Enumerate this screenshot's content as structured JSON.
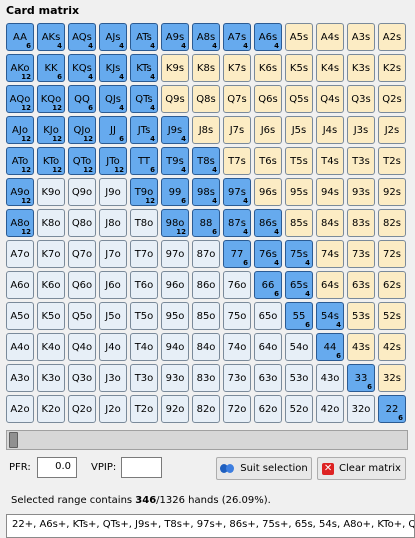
{
  "panel": {
    "title": "Card matrix"
  },
  "matrix": {
    "rows": [
      [
        [
          "AA",
          "6",
          true
        ],
        [
          "AKs",
          "4",
          true
        ],
        [
          "AQs",
          "4",
          true
        ],
        [
          "AJs",
          "4",
          true
        ],
        [
          "ATs",
          "4",
          true
        ],
        [
          "A9s",
          "4",
          true
        ],
        [
          "A8s",
          "4",
          true
        ],
        [
          "A7s",
          "4",
          true
        ],
        [
          "A6s",
          "4",
          true
        ],
        [
          "A5s",
          "",
          false
        ],
        [
          "A4s",
          "",
          false
        ],
        [
          "A3s",
          "",
          false
        ],
        [
          "A2s",
          "",
          false
        ]
      ],
      [
        [
          "AKo",
          "12",
          true
        ],
        [
          "KK",
          "6",
          true
        ],
        [
          "KQs",
          "4",
          true
        ],
        [
          "KJs",
          "4",
          true
        ],
        [
          "KTs",
          "4",
          true
        ],
        [
          "K9s",
          "",
          false
        ],
        [
          "K8s",
          "",
          false
        ],
        [
          "K7s",
          "",
          false
        ],
        [
          "K6s",
          "",
          false
        ],
        [
          "K5s",
          "",
          false
        ],
        [
          "K4s",
          "",
          false
        ],
        [
          "K3s",
          "",
          false
        ],
        [
          "K2s",
          "",
          false
        ]
      ],
      [
        [
          "AQo",
          "12",
          true
        ],
        [
          "KQo",
          "12",
          true
        ],
        [
          "QQ",
          "6",
          true
        ],
        [
          "QJs",
          "4",
          true
        ],
        [
          "QTs",
          "4",
          true
        ],
        [
          "Q9s",
          "",
          false
        ],
        [
          "Q8s",
          "",
          false
        ],
        [
          "Q7s",
          "",
          false
        ],
        [
          "Q6s",
          "",
          false
        ],
        [
          "Q5s",
          "",
          false
        ],
        [
          "Q4s",
          "",
          false
        ],
        [
          "Q3s",
          "",
          false
        ],
        [
          "Q2s",
          "",
          false
        ]
      ],
      [
        [
          "AJo",
          "12",
          true
        ],
        [
          "KJo",
          "12",
          true
        ],
        [
          "QJo",
          "12",
          true
        ],
        [
          "JJ",
          "6",
          true
        ],
        [
          "JTs",
          "4",
          true
        ],
        [
          "J9s",
          "4",
          true
        ],
        [
          "J8s",
          "",
          false
        ],
        [
          "J7s",
          "",
          false
        ],
        [
          "J6s",
          "",
          false
        ],
        [
          "J5s",
          "",
          false
        ],
        [
          "J4s",
          "",
          false
        ],
        [
          "J3s",
          "",
          false
        ],
        [
          "J2s",
          "",
          false
        ]
      ],
      [
        [
          "ATo",
          "12",
          true
        ],
        [
          "KTo",
          "12",
          true
        ],
        [
          "QTo",
          "12",
          true
        ],
        [
          "JTo",
          "12",
          true
        ],
        [
          "TT",
          "6",
          true
        ],
        [
          "T9s",
          "4",
          true
        ],
        [
          "T8s",
          "4",
          true
        ],
        [
          "T7s",
          "",
          false
        ],
        [
          "T6s",
          "",
          false
        ],
        [
          "T5s",
          "",
          false
        ],
        [
          "T4s",
          "",
          false
        ],
        [
          "T3s",
          "",
          false
        ],
        [
          "T2s",
          "",
          false
        ]
      ],
      [
        [
          "A9o",
          "12",
          true
        ],
        [
          "K9o",
          "",
          false
        ],
        [
          "Q9o",
          "",
          false
        ],
        [
          "J9o",
          "",
          false
        ],
        [
          "T9o",
          "12",
          true
        ],
        [
          "99",
          "6",
          true
        ],
        [
          "98s",
          "4",
          true
        ],
        [
          "97s",
          "4",
          true
        ],
        [
          "96s",
          "",
          false
        ],
        [
          "95s",
          "",
          false
        ],
        [
          "94s",
          "",
          false
        ],
        [
          "93s",
          "",
          false
        ],
        [
          "92s",
          "",
          false
        ]
      ],
      [
        [
          "A8o",
          "12",
          true
        ],
        [
          "K8o",
          "",
          false
        ],
        [
          "Q8o",
          "",
          false
        ],
        [
          "J8o",
          "",
          false
        ],
        [
          "T8o",
          "",
          false
        ],
        [
          "98o",
          "12",
          true
        ],
        [
          "88",
          "6",
          true
        ],
        [
          "87s",
          "4",
          true
        ],
        [
          "86s",
          "4",
          true
        ],
        [
          "85s",
          "",
          false
        ],
        [
          "84s",
          "",
          false
        ],
        [
          "83s",
          "",
          false
        ],
        [
          "82s",
          "",
          false
        ]
      ],
      [
        [
          "A7o",
          "",
          false
        ],
        [
          "K7o",
          "",
          false
        ],
        [
          "Q7o",
          "",
          false
        ],
        [
          "J7o",
          "",
          false
        ],
        [
          "T7o",
          "",
          false
        ],
        [
          "97o",
          "",
          false
        ],
        [
          "87o",
          "",
          false
        ],
        [
          "77",
          "6",
          true
        ],
        [
          "76s",
          "4",
          true
        ],
        [
          "75s",
          "4",
          true
        ],
        [
          "74s",
          "",
          false
        ],
        [
          "73s",
          "",
          false
        ],
        [
          "72s",
          "",
          false
        ]
      ],
      [
        [
          "A6o",
          "",
          false
        ],
        [
          "K6o",
          "",
          false
        ],
        [
          "Q6o",
          "",
          false
        ],
        [
          "J6o",
          "",
          false
        ],
        [
          "T6o",
          "",
          false
        ],
        [
          "96o",
          "",
          false
        ],
        [
          "86o",
          "",
          false
        ],
        [
          "76o",
          "",
          false
        ],
        [
          "66",
          "6",
          true
        ],
        [
          "65s",
          "4",
          true
        ],
        [
          "64s",
          "",
          false
        ],
        [
          "63s",
          "",
          false
        ],
        [
          "62s",
          "",
          false
        ]
      ],
      [
        [
          "A5o",
          "",
          false
        ],
        [
          "K5o",
          "",
          false
        ],
        [
          "Q5o",
          "",
          false
        ],
        [
          "J5o",
          "",
          false
        ],
        [
          "T5o",
          "",
          false
        ],
        [
          "95o",
          "",
          false
        ],
        [
          "85o",
          "",
          false
        ],
        [
          "75o",
          "",
          false
        ],
        [
          "65o",
          "",
          false
        ],
        [
          "55",
          "6",
          true
        ],
        [
          "54s",
          "4",
          true
        ],
        [
          "53s",
          "",
          false
        ],
        [
          "52s",
          "",
          false
        ]
      ],
      [
        [
          "A4o",
          "",
          false
        ],
        [
          "K4o",
          "",
          false
        ],
        [
          "Q4o",
          "",
          false
        ],
        [
          "J4o",
          "",
          false
        ],
        [
          "T4o",
          "",
          false
        ],
        [
          "94o",
          "",
          false
        ],
        [
          "84o",
          "",
          false
        ],
        [
          "74o",
          "",
          false
        ],
        [
          "64o",
          "",
          false
        ],
        [
          "54o",
          "",
          false
        ],
        [
          "44",
          "6",
          true
        ],
        [
          "43s",
          "",
          false
        ],
        [
          "42s",
          "",
          false
        ]
      ],
      [
        [
          "A3o",
          "",
          false
        ],
        [
          "K3o",
          "",
          false
        ],
        [
          "Q3o",
          "",
          false
        ],
        [
          "J3o",
          "",
          false
        ],
        [
          "T3o",
          "",
          false
        ],
        [
          "93o",
          "",
          false
        ],
        [
          "83o",
          "",
          false
        ],
        [
          "73o",
          "",
          false
        ],
        [
          "63o",
          "",
          false
        ],
        [
          "53o",
          "",
          false
        ],
        [
          "43o",
          "",
          false
        ],
        [
          "33",
          "6",
          true
        ],
        [
          "32s",
          "",
          false
        ]
      ],
      [
        [
          "A2o",
          "",
          false
        ],
        [
          "K2o",
          "",
          false
        ],
        [
          "Q2o",
          "",
          false
        ],
        [
          "J2o",
          "",
          false
        ],
        [
          "T2o",
          "",
          false
        ],
        [
          "92o",
          "",
          false
        ],
        [
          "82o",
          "",
          false
        ],
        [
          "72o",
          "",
          false
        ],
        [
          "62o",
          "",
          false
        ],
        [
          "52o",
          "",
          false
        ],
        [
          "42o",
          "",
          false
        ],
        [
          "32o",
          "",
          false
        ],
        [
          "22",
          "6",
          true
        ]
      ]
    ]
  },
  "slider": {
    "value": 0
  },
  "controls": {
    "pfr_label": "PFR:",
    "pfr_value": "0.0",
    "vpip_label": "VPIP:",
    "vpip_value": "",
    "suit_button": "Suit selection",
    "suit_icon": "suit-selection-icon",
    "clear_button": "Clear matrix",
    "clear_icon": "clear-x-icon"
  },
  "summary": {
    "prefix": "Selected range contains ",
    "selected": "346",
    "total": "/1326 hands (26.09%)."
  },
  "range_text": "22+, A6s+, KTs+, QTs+, J9s+, T8s+, 97s+, 86s+, 75s+, 65s, 54s, A8o+, KTo+, QTo+, JTo, T9o, 98o",
  "colors": {
    "selected": "#66aaee",
    "suited": "#fcecc4",
    "offsuit": "#e7eff7"
  }
}
